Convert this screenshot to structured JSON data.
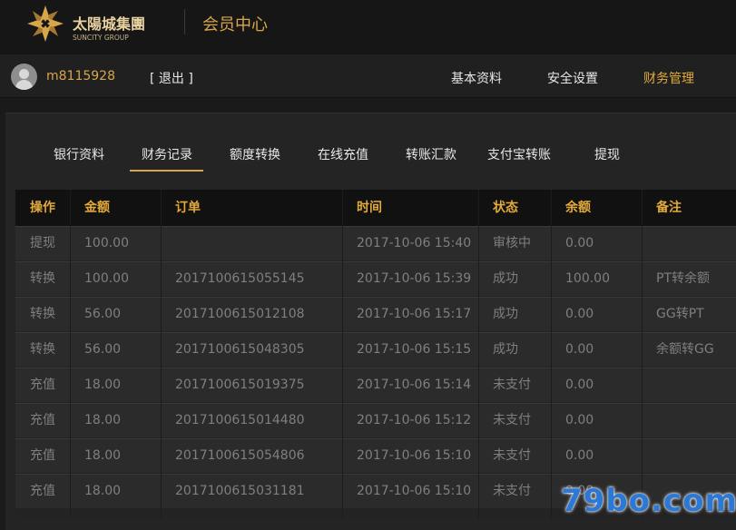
{
  "brand": {
    "logo_cn": "太陽城集團",
    "logo_en": "SUNCITY GROUP",
    "page_title": "会员中心"
  },
  "user": {
    "name": "m8115928",
    "logout": "[ 退出 ]"
  },
  "top_nav": [
    {
      "label": "基本资料",
      "active": false
    },
    {
      "label": "安全设置",
      "active": false
    },
    {
      "label": "财务管理",
      "active": true
    }
  ],
  "sub_tabs": [
    {
      "label": "银行资料",
      "active": false
    },
    {
      "label": "财务记录",
      "active": true
    },
    {
      "label": "额度转换",
      "active": false
    },
    {
      "label": "在线充值",
      "active": false
    },
    {
      "label": "转账汇款",
      "active": false
    },
    {
      "label": "支付宝转账",
      "active": false
    },
    {
      "label": "提现",
      "active": false
    }
  ],
  "table": {
    "headers": [
      "操作",
      "金额",
      "订单",
      "时间",
      "状态",
      "余额",
      "备注"
    ],
    "rows": [
      [
        "提现",
        "100.00",
        "",
        "2017-10-06 15:40",
        "审核中",
        "0.00",
        ""
      ],
      [
        "转换",
        "100.00",
        "2017100615055145",
        "2017-10-06 15:39",
        "成功",
        "100.00",
        "PT转余额"
      ],
      [
        "转换",
        "56.00",
        "2017100615012108",
        "2017-10-06 15:17",
        "成功",
        "0.00",
        "GG转PT"
      ],
      [
        "转换",
        "56.00",
        "2017100615048305",
        "2017-10-06 15:15",
        "成功",
        "0.00",
        "余额转GG"
      ],
      [
        "充值",
        "18.00",
        "2017100615019375",
        "2017-10-06 15:14",
        "未支付",
        "0.00",
        ""
      ],
      [
        "充值",
        "18.00",
        "2017100615014480",
        "2017-10-06 15:12",
        "未支付",
        "0.00",
        ""
      ],
      [
        "充值",
        "18.00",
        "2017100615054806",
        "2017-10-06 15:10",
        "未支付",
        "0.00",
        ""
      ],
      [
        "充值",
        "18.00",
        "2017100615031181",
        "2017-10-06 15:10",
        "未支付",
        "0.00",
        ""
      ]
    ]
  },
  "watermark": "79bo.com",
  "colors": {
    "accent": "#e2aa3b",
    "title": "#d7a64a",
    "text": "#e8e8e8",
    "muted": "#7f7f7f",
    "watermark": "#2b78d6"
  }
}
